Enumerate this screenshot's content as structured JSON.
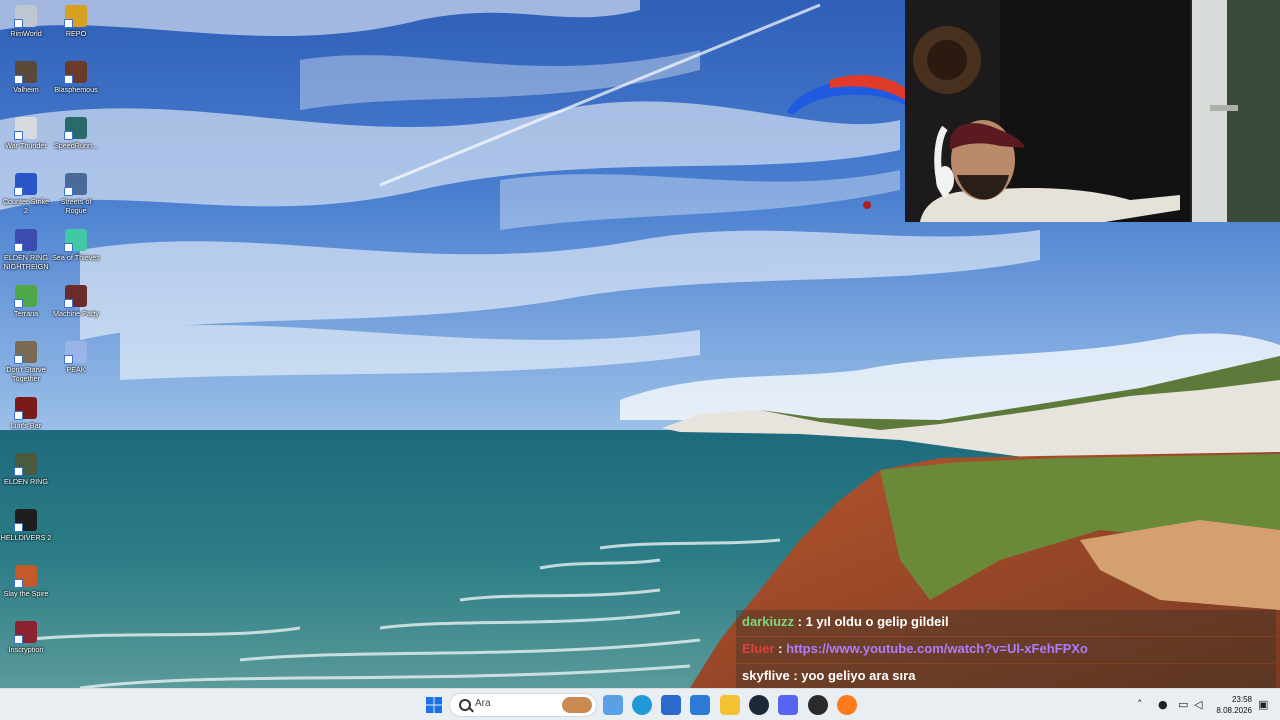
{
  "desktop": {
    "icons": [
      {
        "label": "RimWorld",
        "color": "#bfc7d0"
      },
      {
        "label": "Valheim",
        "color": "#5a4a3a"
      },
      {
        "label": "War Thunder",
        "color": "#d6dbe0"
      },
      {
        "label": "Counter-Strike 2",
        "color": "#2b54c9"
      },
      {
        "label": "ELDEN RING NIGHTREIGN",
        "color": "#3b4bb0"
      },
      {
        "label": "Terraria",
        "color": "#4fa84a"
      },
      {
        "label": "Don't Starve Together",
        "color": "#7a6a52"
      },
      {
        "label": "Liar's Bar",
        "color": "#7a1b1b"
      },
      {
        "label": "ELDEN RING",
        "color": "#4a5a3f"
      },
      {
        "label": "HELLDIVERS 2",
        "color": "#1e1e1e"
      },
      {
        "label": "Slay the Spire",
        "color": "#c45a2a"
      },
      {
        "label": "Inscryption",
        "color": "#8a2230"
      },
      {
        "label": "REPO",
        "color": "#d8a020"
      },
      {
        "label": "Blasphemous",
        "color": "#6a3a2a"
      },
      {
        "label": "SpeedRunn...",
        "color": "#2a6a6a"
      },
      {
        "label": "Streets of Rogue",
        "color": "#4a6a9a"
      },
      {
        "label": "Sea of Thieves",
        "color": "#3fc9a4"
      },
      {
        "label": "Machine Party",
        "color": "#6b2b2b"
      },
      {
        "label": "PEAK",
        "color": "#9ab3e8"
      }
    ]
  },
  "chat": {
    "messages": [
      {
        "user": "darkiuzz",
        "user_color": "#7dd87d",
        "text": "1 yıl oldu o gelip gildeil",
        "is_link": false
      },
      {
        "user": "Eluer",
        "user_color": "#e04040",
        "text": "https://www.youtube.com/watch?v=Ul-xFehFPXo",
        "is_link": true
      },
      {
        "user": "skyflive",
        "user_color": "#ffffff",
        "text": "yoo geliyo ara sıra",
        "is_link": false
      }
    ],
    "separator": " : "
  },
  "taskbar": {
    "search_placeholder": "Ara",
    "apps": [
      {
        "name": "start-icon",
        "color": "#1a73e8"
      },
      {
        "name": "widgets-icon",
        "color": "#5aa0e6"
      },
      {
        "name": "edge-icon",
        "color": "#1f9ad6"
      },
      {
        "name": "store-icon",
        "color": "#2a6acb"
      },
      {
        "name": "outlook-icon",
        "color": "#2a7ad6"
      },
      {
        "name": "file-explorer-icon",
        "color": "#f2c233"
      },
      {
        "name": "steam-icon",
        "color": "#1b2838"
      },
      {
        "name": "discord-icon",
        "color": "#5865f2"
      },
      {
        "name": "obs-icon",
        "color": "#2a2a2a"
      },
      {
        "name": "firefox-icon",
        "color": "#ff7a1a"
      }
    ],
    "clock": {
      "time": "23:58",
      "date": "8.08.2026"
    }
  }
}
